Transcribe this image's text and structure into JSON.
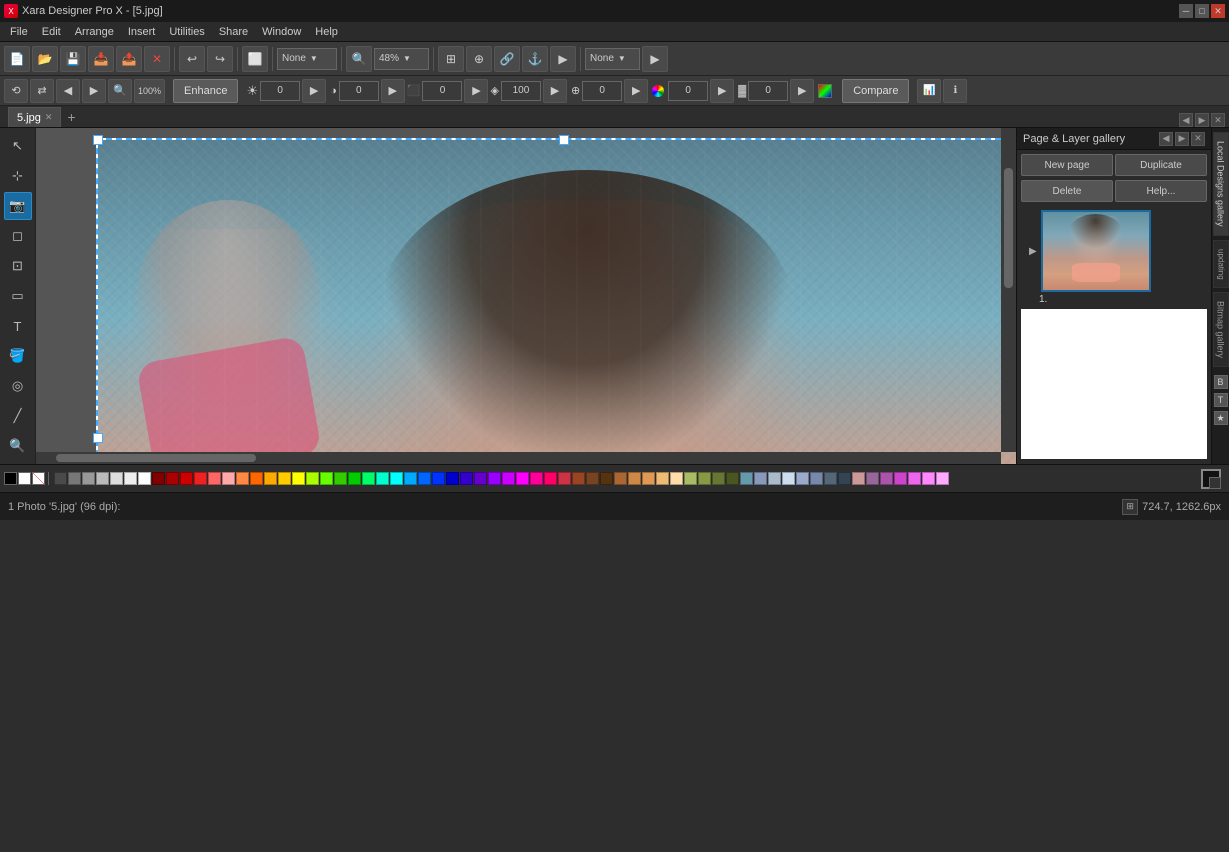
{
  "titlebar": {
    "title": "Xara Designer Pro X - [5.jpg]",
    "icon": "xara-icon",
    "winbtns": [
      "minimize",
      "maximize",
      "close"
    ]
  },
  "menubar": {
    "items": [
      "File",
      "Edit",
      "Arrange",
      "Insert",
      "Utilities",
      "Share",
      "Window",
      "Help"
    ]
  },
  "toolbar1": {
    "zoom_value": "48%",
    "zoom_placeholder": "48%",
    "style_dropdown": "None",
    "buttons": [
      "new",
      "open",
      "save",
      "copy",
      "paste",
      "delete",
      "undo",
      "redo",
      "transform",
      "zoom-in",
      "zoom-out",
      "zoom-percent"
    ],
    "right_dropdown": "None"
  },
  "toolbar2": {
    "enhance_label": "Enhance",
    "brightness_value": "0",
    "contrast_value": "0",
    "saturation_value": "0",
    "sharpness_value": "100",
    "blur_value": "0",
    "hue_value": "0",
    "opacity_value": "0",
    "compare_label": "Compare",
    "icons": [
      "prev-frame",
      "next-frame",
      "first-frame",
      "last-frame",
      "zoom-fit"
    ]
  },
  "tabs": [
    {
      "label": "5.jpg",
      "active": true
    },
    {
      "label": "+",
      "active": false
    }
  ],
  "canvas": {
    "background": "#666",
    "image_file": "5.jpg"
  },
  "right_panel": {
    "title": "Page & Layer gallery",
    "buttons": {
      "new_page": "New page",
      "duplicate": "Duplicate",
      "delete": "Delete",
      "help": "Help..."
    },
    "pages": [
      {
        "label": "1.",
        "active": true
      }
    ],
    "side_tabs": [
      "Local Designs gallery",
      "updating",
      "Bitmap gallery",
      "B",
      "T",
      "star"
    ]
  },
  "statusbar": {
    "info": "1 Photo '5.jpg' (96 dpi):",
    "coords": "724.7, 1262.6px"
  },
  "palette": {
    "special": [
      "black",
      "white",
      "transparent"
    ],
    "colors": [
      "#2d2d2d",
      "#555",
      "#888",
      "#aaa",
      "#ccc",
      "#eee",
      "#fff",
      "#800000",
      "#c00",
      "#e00",
      "#f44",
      "#f88",
      "#fcc",
      "#faa",
      "#f84",
      "#fa0",
      "#fc0",
      "#ff0",
      "#cf0",
      "#9f0",
      "#6f0",
      "#3f0",
      "#0f0",
      "#0f3",
      "#0f6",
      "#0f9",
      "#0fc",
      "#0ff",
      "#09f",
      "#06f",
      "#03f",
      "#00f",
      "#00c",
      "#009",
      "#339",
      "#669",
      "#99c",
      "#ccf",
      "#c9f",
      "#c6f",
      "#c3f",
      "#c0f",
      "#f0f",
      "#f09",
      "#f06",
      "#f03",
      "#c00",
      "#900",
      "#600",
      "#300",
      "#310",
      "#620",
      "#930",
      "#c40",
      "#f50",
      "#f80",
      "#fa0",
      "#fd0",
      "#ff3",
      "#ff6",
      "#ff9",
      "#ffc",
      "#ffe",
      "#ea0",
      "#c80",
      "#a60",
      "#840",
      "#620",
      "#430",
      "#210"
    ],
    "right_color": "#111"
  }
}
